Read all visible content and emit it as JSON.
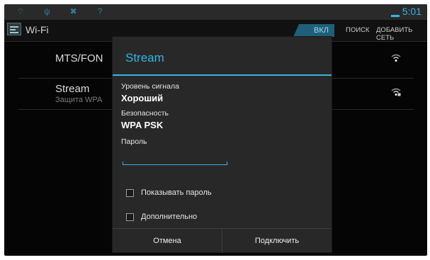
{
  "status_bar": {
    "time": "5:01",
    "icons": [
      "notification-icon",
      "usb-icon",
      "tools-icon",
      "unknown-icon"
    ],
    "accent_color": "#33b5e5"
  },
  "action_bar": {
    "title": "Wi-Fi",
    "switch_label": "ВКЛ",
    "search_label": "ПОИСК",
    "add_network_label": "ДОБАВИТЬ СЕТЬ"
  },
  "networks": [
    {
      "name": "MTS/FON",
      "subtitle": ""
    },
    {
      "name": "Stream",
      "subtitle": "Защита WPA"
    }
  ],
  "dialog": {
    "title": "Stream",
    "signal_label": "Уровень сигнала",
    "signal_value": "Хороший",
    "security_label": "Безопасность",
    "security_value": "WPA PSK",
    "password_label": "Пароль",
    "password_value": "",
    "show_password_label": "Показывать пароль",
    "advanced_label": "Дополнительно",
    "cancel_label": "Отмена",
    "connect_label": "Подключить"
  }
}
